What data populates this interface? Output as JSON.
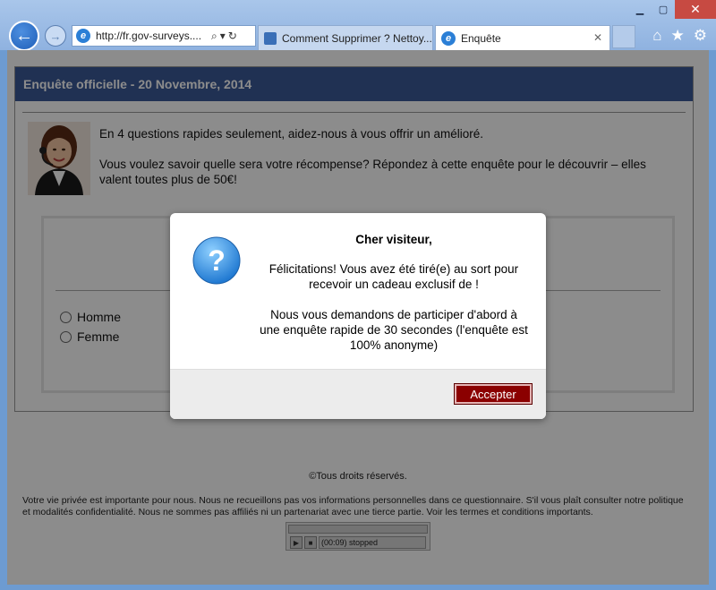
{
  "browser": {
    "address": "http://fr.gov-surveys....",
    "tabs": [
      {
        "label": "Comment Supprimer ? Nettoy..."
      },
      {
        "label": "Enquête"
      }
    ]
  },
  "page": {
    "header_title": "Enquête officielle - 20 Novembre, 2014",
    "intro_1": "En 4 questions rapides seulement, aidez-nous à vous offrir un amélioré.",
    "intro_2": "Vous voulez savoir quelle sera votre récompense? Répondez à cette enquête pour le découvrir – elles valent toutes plus de 50€!",
    "options": [
      {
        "label": "Homme"
      },
      {
        "label": "Femme"
      }
    ],
    "copyright": "©Tous droits réservés.",
    "privacy": "Votre vie privée est importante pour nous. Nous ne recueillons pas vos informations personnelles dans ce questionnaire. S'il vous plaît consulter notre politique et modalités confidentialité. Nous ne sommes pas affiliés ni un partenariat avec une tierce partie. Voir les termes et conditions importants.",
    "player_time": "(00:09) stopped"
  },
  "modal": {
    "title": "Cher visiteur,",
    "text_1": "Félicitations! Vous avez été tiré(e) au sort pour recevoir un cadeau exclusif de !",
    "text_2": "Nous vous demandons de participer d'abord à une enquête rapide de 30 secondes (l'enquête est 100% anonyme)",
    "accept_label": "Accepter"
  },
  "colors": {
    "header_bg": "#3b5998",
    "accept_bg": "#8b0000",
    "ie_blue": "#2b7fd6"
  }
}
